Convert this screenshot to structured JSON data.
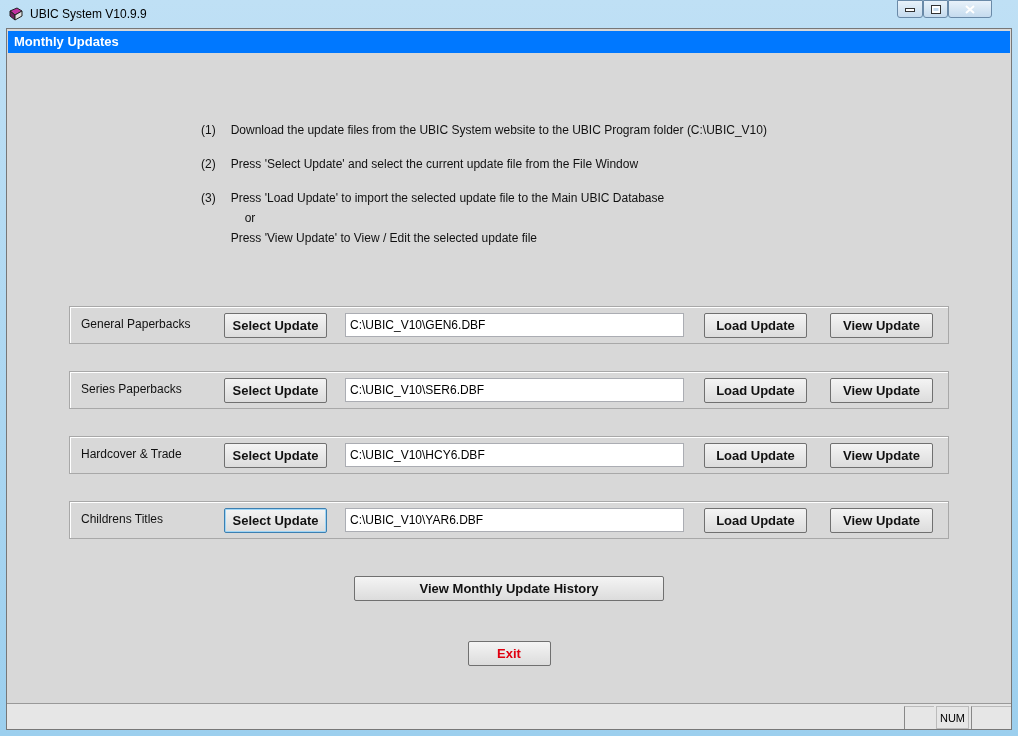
{
  "window": {
    "title": "UBIC System V10.9.9"
  },
  "header": {
    "title": "Monthly Updates"
  },
  "instructions": [
    {
      "number": "(1)",
      "lines": [
        "Download the update files from the UBIC System website to the UBIC Program folder (C:\\UBIC_V10)"
      ]
    },
    {
      "number": "(2)",
      "lines": [
        "Press 'Select Update' and select the current update file from the File Window"
      ]
    },
    {
      "number": "(3)",
      "lines": [
        "Press 'Load Update' to import the selected update file to the Main UBIC Database",
        "or",
        "Press 'View Update' to View / Edit the selected update file"
      ]
    }
  ],
  "update_rows": [
    {
      "label": "General Paperbacks",
      "select_button": "Select Update",
      "file": "C:\\UBIC_V10\\GEN6.DBF",
      "load_button": "Load Update",
      "view_button": "View Update",
      "focused": false
    },
    {
      "label": "Series Paperbacks",
      "select_button": "Select Update",
      "file": "C:\\UBIC_V10\\SER6.DBF",
      "load_button": "Load Update",
      "view_button": "View Update",
      "focused": false
    },
    {
      "label": "Hardcover & Trade",
      "select_button": "Select Update",
      "file": "C:\\UBIC_V10\\HCY6.DBF",
      "load_button": "Load Update",
      "view_button": "View Update",
      "focused": false
    },
    {
      "label": "Childrens Titles",
      "select_button": "Select Update",
      "file": "C:\\UBIC_V10\\YAR6.DBF",
      "load_button": "Load Update",
      "view_button": "View Update",
      "focused": true
    }
  ],
  "history_button": "View Monthly Update History",
  "exit_button": "Exit",
  "status_bar": {
    "num": "NUM"
  }
}
